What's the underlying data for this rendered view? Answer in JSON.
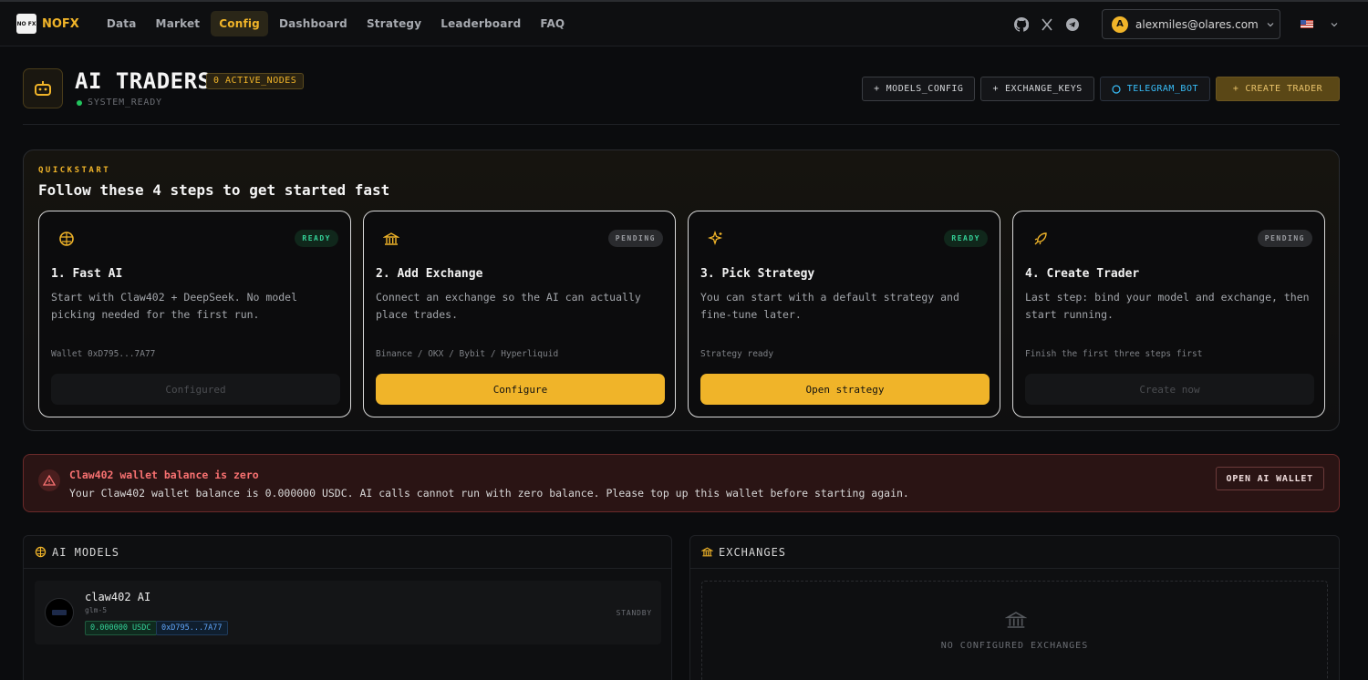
{
  "nav": {
    "brand": "NOFX",
    "logo_text": "NO FX",
    "links": [
      "Data",
      "Market",
      "Config",
      "Dashboard",
      "Strategy",
      "Leaderboard",
      "FAQ"
    ],
    "active": "Config",
    "user_initial": "A",
    "user_email": "alexmiles@olares.com",
    "social_icons": [
      "github-icon",
      "x-icon",
      "telegram-icon"
    ]
  },
  "header": {
    "title": "AI TRADERS",
    "nodes_badge": "0 ACTIVE_NODES",
    "status": "SYSTEM_READY",
    "buttons": {
      "models": "MODELS_CONFIG",
      "exchange": "EXCHANGE_KEYS",
      "telegram": "TELEGRAM_BOT",
      "create": "CREATE TRADER"
    }
  },
  "quickstart": {
    "eyebrow": "QUICKSTART",
    "title": "Follow these 4 steps to get started fast",
    "cards": [
      {
        "badge": "READY",
        "title": "1. Fast AI",
        "desc": "Start with Claw402 + DeepSeek. No model picking needed for the first run.",
        "meta": "Wallet 0xD795...7A77",
        "button": "Configured"
      },
      {
        "badge": "PENDING",
        "title": "2. Add Exchange",
        "desc": "Connect an exchange so the AI can actually place trades.",
        "meta": "Binance / OKX / Bybit / Hyperliquid",
        "button": "Configure"
      },
      {
        "badge": "READY",
        "title": "3. Pick Strategy",
        "desc": "You can start with a default strategy and fine-tune later.",
        "meta": "Strategy ready",
        "button": "Open strategy"
      },
      {
        "badge": "PENDING",
        "title": "4. Create Trader",
        "desc": "Last step: bind your model and exchange, then start running.",
        "meta": "Finish the first three steps first",
        "button": "Create now"
      }
    ]
  },
  "alert": {
    "title": "Claw402 wallet balance is zero",
    "text": "Your Claw402 wallet balance is 0.000000 USDC. AI calls cannot run with zero balance. Please top up this wallet before starting again.",
    "button": "OPEN AI WALLET"
  },
  "models_panel": {
    "title": "AI MODELS",
    "model": {
      "name": "claw402 AI",
      "sub": "glm-5",
      "balance": "0.000000 USDC",
      "address": "0xD795...7A77",
      "state": "STANDBY"
    }
  },
  "exchanges_panel": {
    "title": "EXCHANGES",
    "empty": "NO CONFIGURED EXCHANGES"
  },
  "colors": {
    "accent": "#f0b429",
    "ready": "#34d399",
    "danger": "#f87171",
    "telegram": "#38bdf8"
  }
}
